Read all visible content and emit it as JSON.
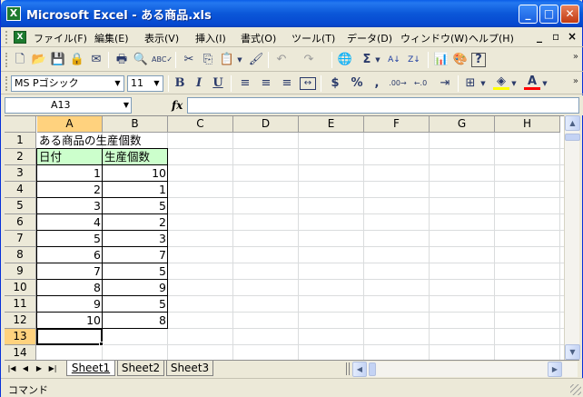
{
  "window": {
    "title": "Microsoft Excel - ある商品.xls",
    "app_icon": "X",
    "buttons": {
      "minimize": "_",
      "maximize": "□",
      "close": "✕"
    }
  },
  "menubar": {
    "items": [
      {
        "label": "ファイル(F)"
      },
      {
        "label": "編集(E)"
      },
      {
        "label": "表示(V)"
      },
      {
        "label": "挿入(I)"
      },
      {
        "label": "書式(O)"
      },
      {
        "label": "ツール(T)"
      },
      {
        "label": "データ(D)"
      },
      {
        "label": "ウィンドウ(W)"
      },
      {
        "label": "ヘルプ(H)"
      }
    ],
    "doc_controls": {
      "minimize": "_",
      "restore": "▫",
      "close": "×"
    }
  },
  "toolbar_standard": {
    "icons": {
      "new": "🗋",
      "open": "📂",
      "save": "💾",
      "permission": "🔒",
      "email": "✉",
      "print": "🖶",
      "preview": "🔍",
      "spelling": "ABC✓",
      "cut": "✂",
      "copy": "⎘",
      "paste": "📋",
      "format_painter": "🖌",
      "undo": "↶",
      "redo": "↷",
      "hyperlink": "🌐",
      "autosum": "Σ",
      "sort_asc": "A↓",
      "sort_desc": "Z↓",
      "chart": "📊",
      "drawing": "🎨",
      "help": "?"
    }
  },
  "toolbar_formatting": {
    "font_name": "MS Pゴシック",
    "font_size": "11",
    "bold": "B",
    "italic": "I",
    "underline": "U",
    "currency": "$",
    "percent": "%",
    "comma": ",",
    "increase_decimal": ".00→",
    "decrease_decimal": "←.0"
  },
  "formula_bar": {
    "name_box": "A13",
    "fx": "fx",
    "value": ""
  },
  "grid": {
    "columns": [
      "A",
      "B",
      "C",
      "D",
      "E",
      "F",
      "G",
      "H"
    ],
    "rows": [
      "1",
      "2",
      "3",
      "4",
      "5",
      "6",
      "7",
      "8",
      "9",
      "10",
      "11",
      "12",
      "13",
      "14"
    ],
    "selected_column": "A",
    "selected_row": "13",
    "title_cell": "ある商品の生産個数",
    "header_a": "日付",
    "header_b": "生産個数",
    "data": [
      {
        "a": 1,
        "b": 10
      },
      {
        "a": 2,
        "b": 1
      },
      {
        "a": 3,
        "b": 5
      },
      {
        "a": 4,
        "b": 2
      },
      {
        "a": 5,
        "b": 3
      },
      {
        "a": 6,
        "b": 7
      },
      {
        "a": 7,
        "b": 5
      },
      {
        "a": 8,
        "b": 9
      },
      {
        "a": 9,
        "b": 5
      },
      {
        "a": 10,
        "b": 8
      }
    ],
    "highlight_color": "#ccffcc"
  },
  "sheets": {
    "tabs": [
      "Sheet1",
      "Sheet2",
      "Sheet3"
    ],
    "active": "Sheet1"
  },
  "statusbar": {
    "text": "コマンド"
  }
}
